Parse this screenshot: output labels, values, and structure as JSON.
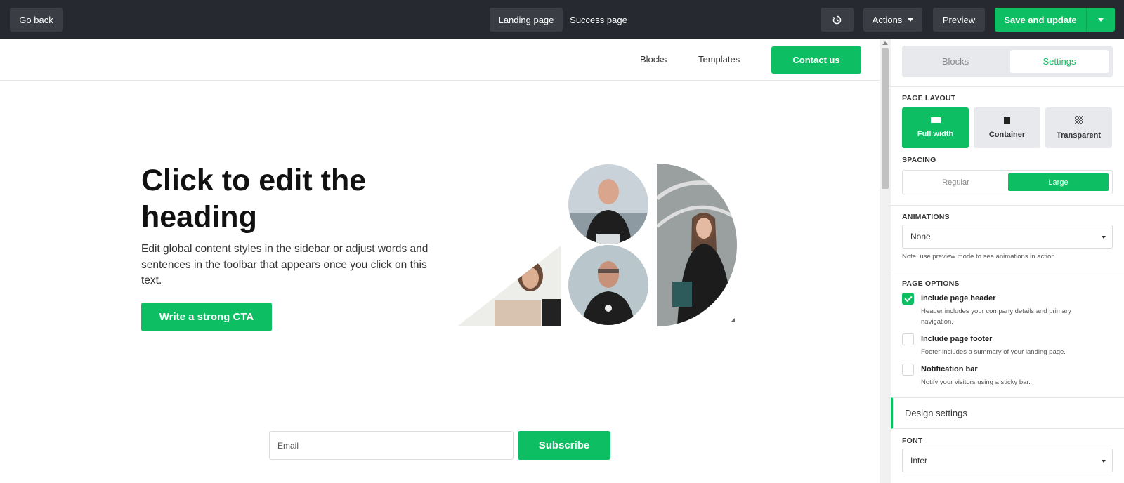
{
  "topbar": {
    "go_back": "Go back",
    "tabs": [
      "Landing page",
      "Success page"
    ],
    "history_icon": "history-icon",
    "actions": "Actions",
    "preview": "Preview",
    "save": "Save and update"
  },
  "page": {
    "nav": {
      "blocks": "Blocks",
      "templates": "Templates",
      "contact": "Contact us"
    },
    "hero": {
      "heading": "Click to edit the heading",
      "text": "Edit global content styles in the sidebar or adjust words and sentences in the toolbar that appears once you click on this text.",
      "cta": "Write a strong CTA"
    },
    "form": {
      "email_placeholder": "Email",
      "subscribe": "Subscribe"
    }
  },
  "sidebar": {
    "tabs": {
      "blocks": "Blocks",
      "settings": "Settings"
    },
    "page_layout": {
      "label": "PAGE LAYOUT",
      "options": [
        "Full width",
        "Container",
        "Transparent"
      ],
      "selected": "Full width"
    },
    "spacing": {
      "label": "SPACING",
      "options": [
        "Regular",
        "Large"
      ],
      "selected": "Large"
    },
    "animations": {
      "label": "ANIMATIONS",
      "value": "None",
      "note": "Note: use preview mode to see animations in action."
    },
    "page_options": {
      "label": "PAGE OPTIONS",
      "items": [
        {
          "title": "Include page header",
          "desc": "Header includes your company details and primary navigation.",
          "checked": true
        },
        {
          "title": "Include page footer",
          "desc": "Footer includes a summary of your landing page.",
          "checked": false
        },
        {
          "title": "Notification bar",
          "desc": "Notify your visitors using a sticky bar.",
          "checked": false
        }
      ]
    },
    "design_settings": "Design settings",
    "font": {
      "label": "FONT",
      "value": "Inter"
    }
  },
  "colors": {
    "accent": "#0dbe62",
    "topbar": "#262a30"
  }
}
